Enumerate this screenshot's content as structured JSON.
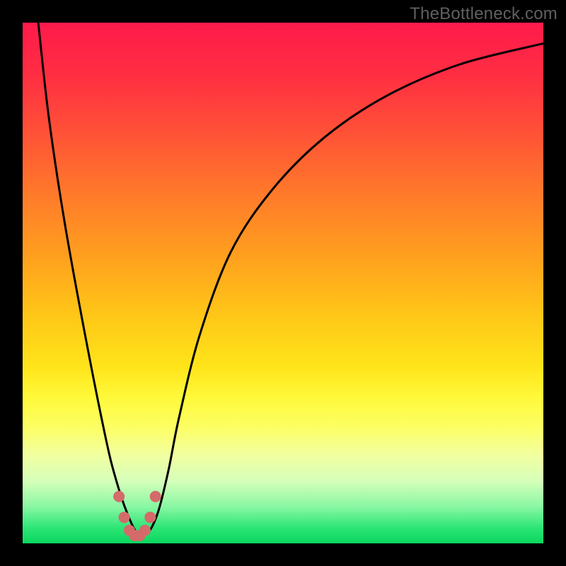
{
  "watermark": "TheBottleneck.com",
  "colors": {
    "background": "#000000",
    "curve": "#000000",
    "marker": "#d46a6a",
    "gradient_top": "#ff1a4b",
    "gradient_bottom": "#0ad760"
  },
  "chart_data": {
    "type": "line",
    "title": "",
    "xlabel": "",
    "ylabel": "",
    "xlim": [
      0,
      100
    ],
    "ylim": [
      0,
      100
    ],
    "grid": false,
    "series": [
      {
        "name": "bottleneck-curve",
        "x": [
          3,
          5,
          8,
          12,
          16,
          18,
          20,
          22,
          24,
          26,
          28,
          30,
          34,
          40,
          48,
          58,
          70,
          84,
          100
        ],
        "values": [
          100,
          82,
          62,
          40,
          20,
          12,
          6,
          2,
          2,
          6,
          14,
          24,
          40,
          56,
          68,
          78,
          86,
          92,
          96
        ]
      }
    ],
    "markers": {
      "name": "highlight-dots",
      "x": [
        18.5,
        19.5,
        20.5,
        21.5,
        22.5,
        23.5,
        24.5,
        25.5
      ],
      "values": [
        9,
        5,
        2.5,
        1.5,
        1.5,
        2.5,
        5,
        9
      ]
    }
  }
}
